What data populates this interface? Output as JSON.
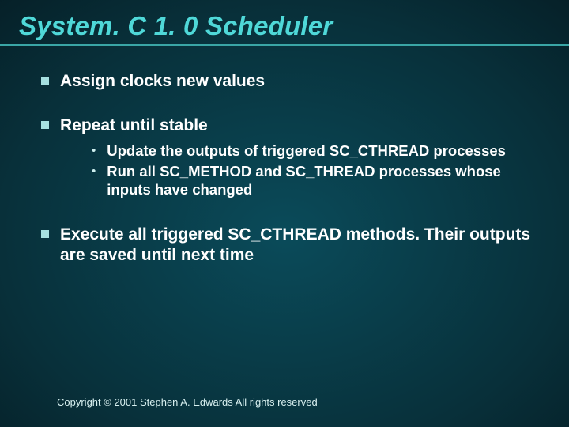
{
  "title": "System. C 1. 0 Scheduler",
  "bullets": [
    {
      "text": "Assign clocks new values",
      "sub": []
    },
    {
      "text": "Repeat until stable",
      "sub": [
        "Update the outputs of triggered SC_CTHREAD processes",
        "Run all SC_METHOD and SC_THREAD processes whose inputs have changed"
      ]
    },
    {
      "text": "Execute all triggered SC_CTHREAD methods.  Their outputs are saved until next time",
      "sub": []
    }
  ],
  "footer": "Copyright © 2001 Stephen A. Edwards  All rights reserved"
}
